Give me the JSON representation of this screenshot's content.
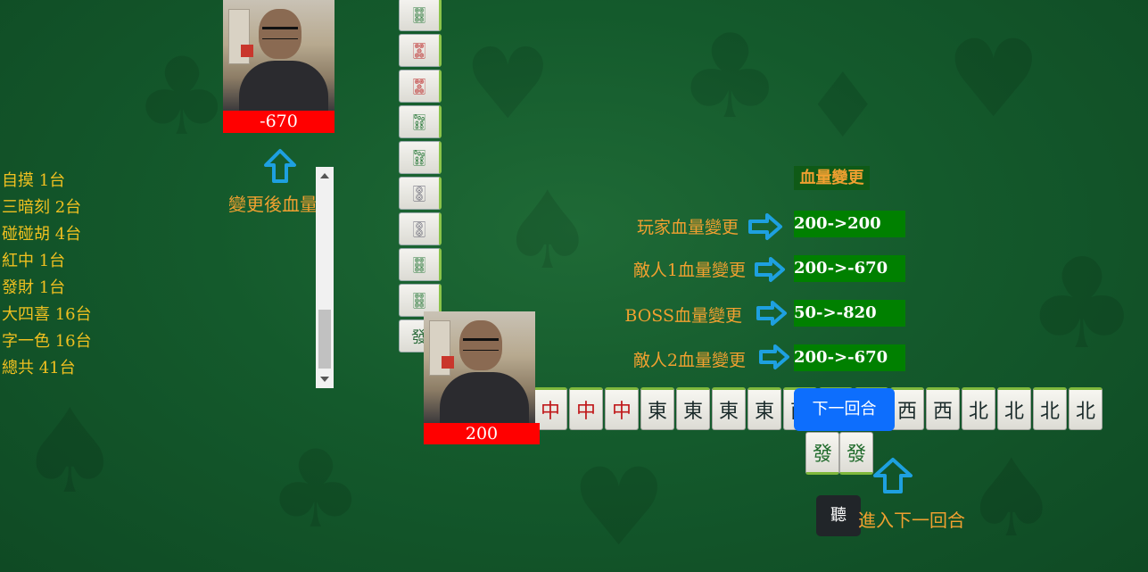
{
  "enemy1": {
    "hp": "-670",
    "caption": "變更後血量"
  },
  "player": {
    "hp": "200"
  },
  "score_list": {
    "items": [
      "自摸 1台",
      "三暗刻 2台",
      "碰碰胡 4台",
      "紅中 1台",
      "發財 1台",
      "大四喜 16台",
      "字一色 16台",
      "總共 41台"
    ]
  },
  "hp_change": {
    "title": "血量變更",
    "rows": [
      {
        "label": "玩家血量變更",
        "value": "200->200"
      },
      {
        "label": "敵人1血量變更",
        "value": "200->-670"
      },
      {
        "label": "BOSS血量變更",
        "value": "50->-820"
      },
      {
        "label": "敵人2血量變更",
        "value": "200->-670"
      }
    ]
  },
  "discard_column": [
    "🀞",
    "🀝",
    "🀝",
    "🀟",
    "🀟",
    "🀚",
    "🀚",
    "🀞",
    "🀞",
    "發"
  ],
  "meld_row": {
    "tiles": [
      "中",
      "中",
      "中",
      "東",
      "東",
      "東",
      "東",
      "南",
      "西",
      "西",
      "西",
      "西",
      "北",
      "北",
      "北",
      "北"
    ]
  },
  "hand": [
    "發",
    "發"
  ],
  "buttons": {
    "next_round": "下一回合",
    "ting": "聽"
  },
  "next_round_caption": "進入下一回合",
  "colors": {
    "accent_orange": "#f0a030",
    "hp_red": "#ff0000",
    "value_green": "#008000",
    "button_blue": "#0d6efd"
  }
}
